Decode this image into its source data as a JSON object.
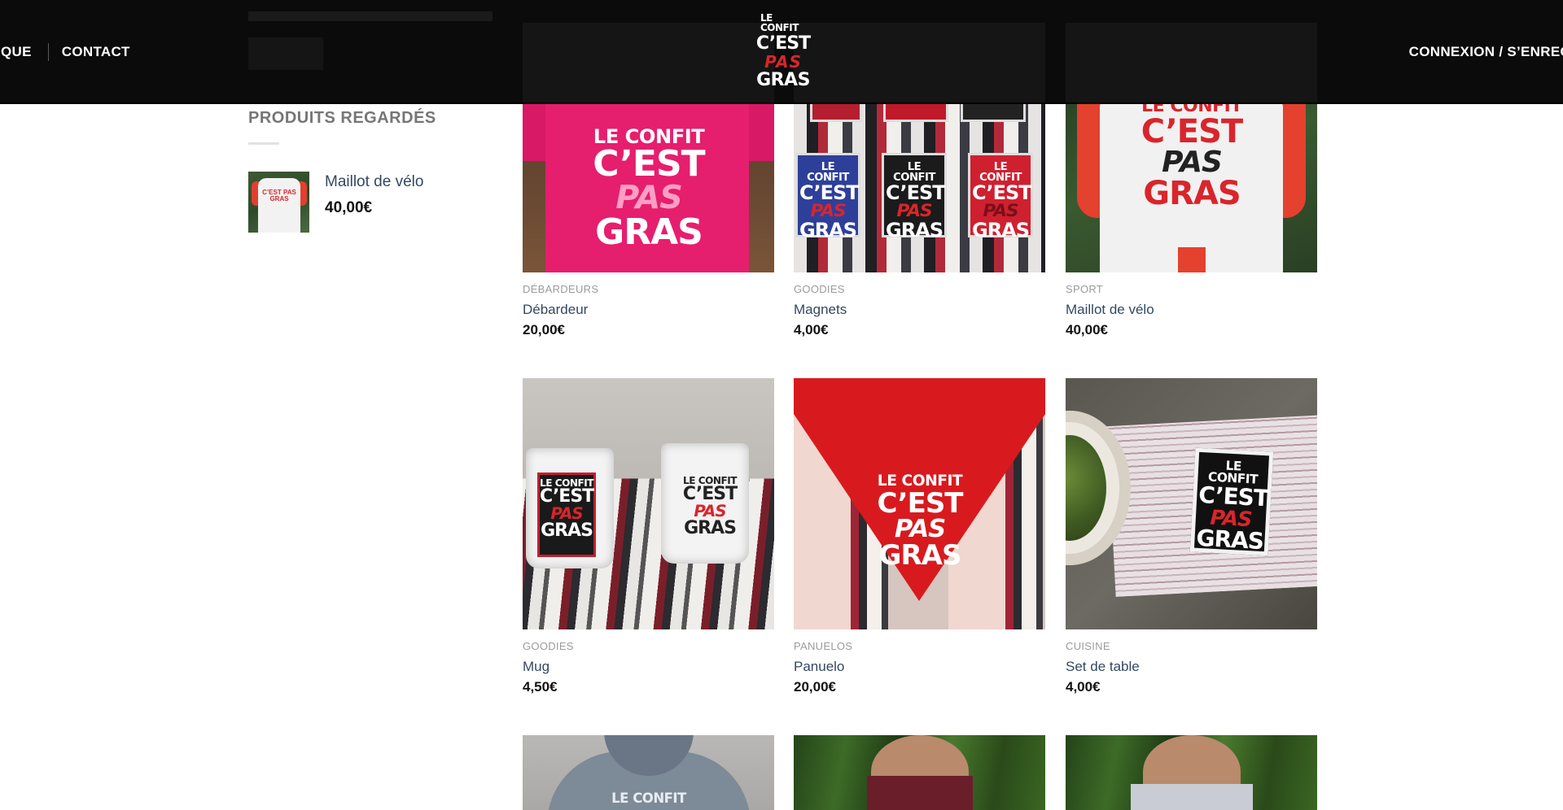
{
  "header": {
    "nav_left": [
      "IQUE",
      "CONTACT"
    ],
    "nav_right": "CONNEXION / S’ENREG",
    "logo": {
      "line1": "LE CONFIT",
      "line2": "C’EST",
      "line3": "PAS",
      "line4": "GRAS"
    }
  },
  "sidebar": {
    "title": "PRODUITS REGARDÉS",
    "item": {
      "name": "Maillot de vélo",
      "price": "40,00€",
      "thumb_text": "C’EST PAS GRAS"
    }
  },
  "products": [
    {
      "category": "DÉBARDEURS",
      "name": "Débardeur",
      "price": "20,00€"
    },
    {
      "category": "GOODIES",
      "name": "Magnets",
      "price": "4,00€"
    },
    {
      "category": "SPORT",
      "name": "Maillot de vélo",
      "price": "40,00€"
    },
    {
      "category": "GOODIES",
      "name": "Mug",
      "price": "4,50€"
    },
    {
      "category": "PANUELOS",
      "name": "Panuelo",
      "price": "20,00€"
    },
    {
      "category": "CUISINE",
      "name": "Set de table",
      "price": "4,00€"
    }
  ],
  "print": {
    "l1": "LE CONFIT",
    "l2": "C’EST",
    "l3": "PAS",
    "l4": "GRAS",
    "partial": "LE CONFIT"
  },
  "colors": {
    "header_bg": "#0b0b0b",
    "link": "#334862",
    "brand_red": "#d9252b"
  }
}
